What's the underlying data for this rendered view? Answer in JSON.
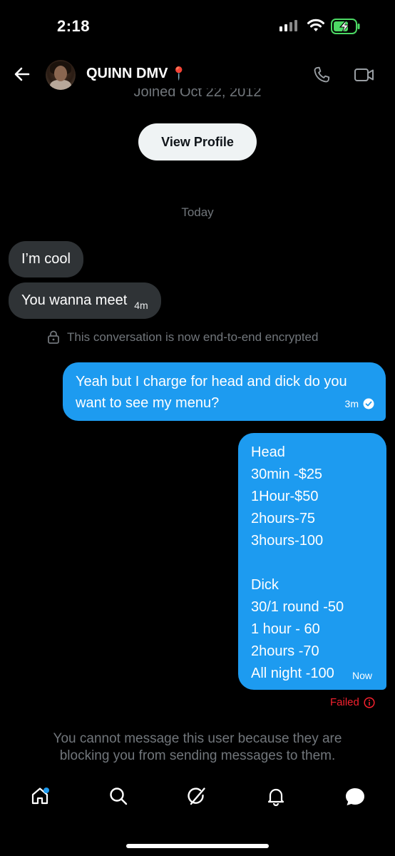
{
  "status_bar": {
    "time": "2:18"
  },
  "header": {
    "contact_name": "QUINN DMV",
    "name_emoji": "📍",
    "subtitle_partial": "Joined Oct 22, 2012",
    "view_profile_label": "View Profile"
  },
  "conversation": {
    "date_separator": "Today",
    "incoming": [
      {
        "text": "I’m cool",
        "time": ""
      },
      {
        "text": "You wanna meet",
        "time": "4m"
      }
    ],
    "encryption_notice": "This conversation is now end-to-end encrypted",
    "outgoing_1": {
      "text": "Yeah but I charge for head and dick do you want to see my menu?",
      "time": "3m"
    },
    "outgoing_2": {
      "lines": [
        "Head",
        "30min -$25",
        "1Hour-$50",
        "2hours-75",
        "3hours-100",
        "",
        "Dick",
        "30/1 round -50",
        "1 hour - 60",
        "2hours -70",
        "All night -100"
      ],
      "time": "Now"
    },
    "failed_label": "Failed",
    "blocked_notice_1": "You cannot message this user because they are",
    "blocked_notice_2": "blocking you from sending messages to them."
  },
  "icons": {
    "back": "back-arrow-icon",
    "phone": "phone-icon",
    "video": "video-icon",
    "lock": "lock-icon",
    "check": "check-circle-icon",
    "info": "info-icon",
    "home": "home-icon",
    "search": "search-icon",
    "grok": "grok-icon",
    "notifications": "bell-icon",
    "messages": "messages-icon"
  },
  "colors": {
    "accent": "#1d9bf0",
    "incoming_bubble": "#2f3336",
    "error": "#f4212e",
    "muted": "#71767b"
  }
}
